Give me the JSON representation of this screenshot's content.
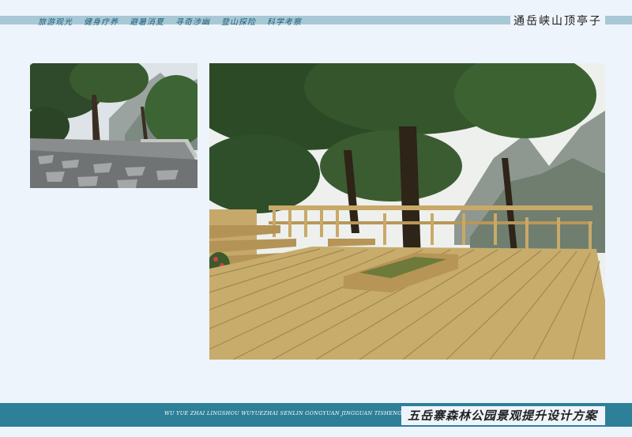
{
  "header": {
    "nav_items": [
      "旅游观光",
      "健身疗养",
      "避暑消夏",
      "寻奇涉幽",
      "登山探险",
      "科学考察"
    ],
    "title": "通岳峡山顶亭子"
  },
  "footer": {
    "romanization": "WU YUE ZHAI LINGSHOU WUYUEZHAI SENLIN GONGYUAN JINGGUAN TISHENG SHEJI FANGAN",
    "title": "五岳寨森林公园景观提升设计方案"
  },
  "colors": {
    "top_band": "#a8c8d6",
    "bottom_band": "#2e7f98",
    "page_bg": "#eef4fb"
  }
}
